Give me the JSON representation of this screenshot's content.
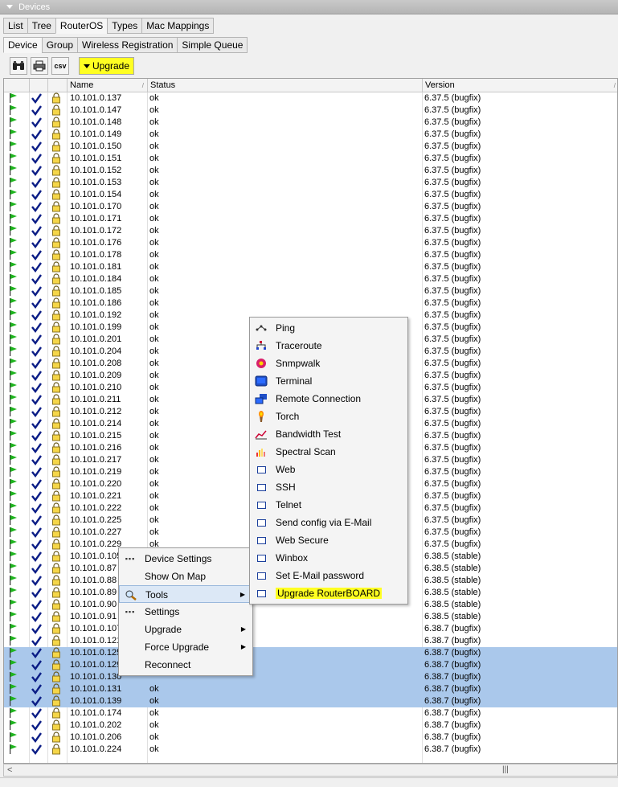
{
  "window": {
    "title": "Devices"
  },
  "tabs_top": [
    "List",
    "Tree",
    "RouterOS",
    "Types",
    "Mac Mappings"
  ],
  "tabs_top_active": 2,
  "tabs_sub": [
    "Device",
    "Group",
    "Wireless Registration",
    "Simple Queue"
  ],
  "tabs_sub_active": 0,
  "toolbar": {
    "find_icon": "binoculars-icon",
    "print_icon": "printer-icon",
    "csv_label": "csv",
    "upgrade_label": "Upgrade",
    "upgrade_color": "#ffff22"
  },
  "table": {
    "columns": [
      "",
      "",
      "",
      "Name",
      "Status",
      "Version"
    ],
    "selection_color": "#aac8eb",
    "rows": [
      [
        "10.101.0.137",
        "ok",
        "6.37.5 (bugfix)"
      ],
      [
        "10.101.0.147",
        "ok",
        "6.37.5 (bugfix)"
      ],
      [
        "10.101.0.148",
        "ok",
        "6.37.5 (bugfix)"
      ],
      [
        "10.101.0.149",
        "ok",
        "6.37.5 (bugfix)"
      ],
      [
        "10.101.0.150",
        "ok",
        "6.37.5 (bugfix)"
      ],
      [
        "10.101.0.151",
        "ok",
        "6.37.5 (bugfix)"
      ],
      [
        "10.101.0.152",
        "ok",
        "6.37.5 (bugfix)"
      ],
      [
        "10.101.0.153",
        "ok",
        "6.37.5 (bugfix)"
      ],
      [
        "10.101.0.154",
        "ok",
        "6.37.5 (bugfix)"
      ],
      [
        "10.101.0.170",
        "ok",
        "6.37.5 (bugfix)"
      ],
      [
        "10.101.0.171",
        "ok",
        "6.37.5 (bugfix)"
      ],
      [
        "10.101.0.172",
        "ok",
        "6.37.5 (bugfix)"
      ],
      [
        "10.101.0.176",
        "ok",
        "6.37.5 (bugfix)"
      ],
      [
        "10.101.0.178",
        "ok",
        "6.37.5 (bugfix)"
      ],
      [
        "10.101.0.181",
        "ok",
        "6.37.5 (bugfix)"
      ],
      [
        "10.101.0.184",
        "ok",
        "6.37.5 (bugfix)"
      ],
      [
        "10.101.0.185",
        "ok",
        "6.37.5 (bugfix)"
      ],
      [
        "10.101.0.186",
        "ok",
        "6.37.5 (bugfix)"
      ],
      [
        "10.101.0.192",
        "ok",
        "6.37.5 (bugfix)"
      ],
      [
        "10.101.0.199",
        "ok",
        "6.37.5 (bugfix)"
      ],
      [
        "10.101.0.201",
        "ok",
        "6.37.5 (bugfix)"
      ],
      [
        "10.101.0.204",
        "ok",
        "6.37.5 (bugfix)"
      ],
      [
        "10.101.0.208",
        "ok",
        "6.37.5 (bugfix)"
      ],
      [
        "10.101.0.209",
        "ok",
        "6.37.5 (bugfix)"
      ],
      [
        "10.101.0.210",
        "ok",
        "6.37.5 (bugfix)"
      ],
      [
        "10.101.0.211",
        "ok",
        "6.37.5 (bugfix)"
      ],
      [
        "10.101.0.212",
        "ok",
        "6.37.5 (bugfix)"
      ],
      [
        "10.101.0.214",
        "ok",
        "6.37.5 (bugfix)"
      ],
      [
        "10.101.0.215",
        "ok",
        "6.37.5 (bugfix)"
      ],
      [
        "10.101.0.216",
        "ok",
        "6.37.5 (bugfix)"
      ],
      [
        "10.101.0.217",
        "ok",
        "6.37.5 (bugfix)"
      ],
      [
        "10.101.0.219",
        "ok",
        "6.37.5 (bugfix)"
      ],
      [
        "10.101.0.220",
        "ok",
        "6.37.5 (bugfix)"
      ],
      [
        "10.101.0.221",
        "ok",
        "6.37.5 (bugfix)"
      ],
      [
        "10.101.0.222",
        "ok",
        "6.37.5 (bugfix)"
      ],
      [
        "10.101.0.225",
        "ok",
        "6.37.5 (bugfix)"
      ],
      [
        "10.101.0.227",
        "ok",
        "6.37.5 (bugfix)"
      ],
      [
        "10.101.0.229",
        "ok",
        "6.37.5 (bugfix)"
      ],
      [
        "10.101.0.105",
        "",
        "6.38.5 (stable)"
      ],
      [
        "10.101.0.87",
        "",
        "6.38.5 (stable)"
      ],
      [
        "10.101.0.88",
        "",
        "6.38.5 (stable)"
      ],
      [
        "10.101.0.89",
        "",
        "6.38.5 (stable)"
      ],
      [
        "10.101.0.90",
        "",
        "6.38.5 (stable)"
      ],
      [
        "10.101.0.91",
        "",
        "6.38.5 (stable)"
      ],
      [
        "10.101.0.107",
        "",
        "6.38.7 (bugfix)"
      ],
      [
        "10.101.0.121",
        "",
        "6.38.7 (bugfix)"
      ],
      [
        "10.101.0.125",
        "",
        "6.38.7 (bugfix)"
      ],
      [
        "10.101.0.129",
        "",
        "6.38.7 (bugfix)"
      ],
      [
        "10.101.0.130",
        "",
        "6.38.7 (bugfix)"
      ],
      [
        "10.101.0.131",
        "ok",
        "6.38.7 (bugfix)"
      ],
      [
        "10.101.0.139",
        "ok",
        "6.38.7 (bugfix)"
      ],
      [
        "10.101.0.174",
        "ok",
        "6.38.7 (bugfix)"
      ],
      [
        "10.101.0.202",
        "ok",
        "6.38.7 (bugfix)"
      ],
      [
        "10.101.0.206",
        "ok",
        "6.38.7 (bugfix)"
      ],
      [
        "10.101.0.224",
        "ok",
        "6.38.7 (bugfix)"
      ]
    ],
    "selected_rows": [
      46,
      47,
      48,
      49,
      50
    ]
  },
  "context_menu": {
    "items": [
      {
        "label": "Device Settings",
        "icon": "dots-icon",
        "submenu": false
      },
      {
        "label": "Show On Map",
        "icon": "",
        "submenu": false
      },
      {
        "label": "Tools",
        "icon": "magnifier-icon",
        "submenu": true,
        "hot": true
      },
      {
        "label": "Settings",
        "icon": "dots-icon",
        "submenu": false
      },
      {
        "label": "Upgrade",
        "icon": "",
        "submenu": true
      },
      {
        "label": "Force Upgrade",
        "icon": "",
        "submenu": true
      },
      {
        "label": "Reconnect",
        "icon": "",
        "submenu": false
      }
    ]
  },
  "tools_menu": {
    "items": [
      {
        "label": "Ping",
        "icon": "ping-icon"
      },
      {
        "label": "Traceroute",
        "icon": "traceroute-icon"
      },
      {
        "label": "Snmpwalk",
        "icon": "snmpwalk-icon"
      },
      {
        "label": "Terminal",
        "icon": "terminal-icon"
      },
      {
        "label": "Remote Connection",
        "icon": "remote-connection-icon"
      },
      {
        "label": "Torch",
        "icon": "torch-icon"
      },
      {
        "label": "Bandwidth Test",
        "icon": "bandwidth-test-icon"
      },
      {
        "label": "Spectral Scan",
        "icon": "spectral-scan-icon"
      },
      {
        "label": "Web",
        "icon": "window-icon"
      },
      {
        "label": "SSH",
        "icon": "window-icon"
      },
      {
        "label": "Telnet",
        "icon": "window-icon"
      },
      {
        "label": "Send config via E-Mail",
        "icon": "window-icon"
      },
      {
        "label": "Web Secure",
        "icon": "window-icon"
      },
      {
        "label": "Winbox",
        "icon": "window-icon"
      },
      {
        "label": "Set E-Mail password",
        "icon": "window-icon"
      },
      {
        "label": "Upgrade RouterBOARD",
        "icon": "window-icon",
        "highlight": true
      }
    ],
    "highlight_color": "#ffff22"
  }
}
